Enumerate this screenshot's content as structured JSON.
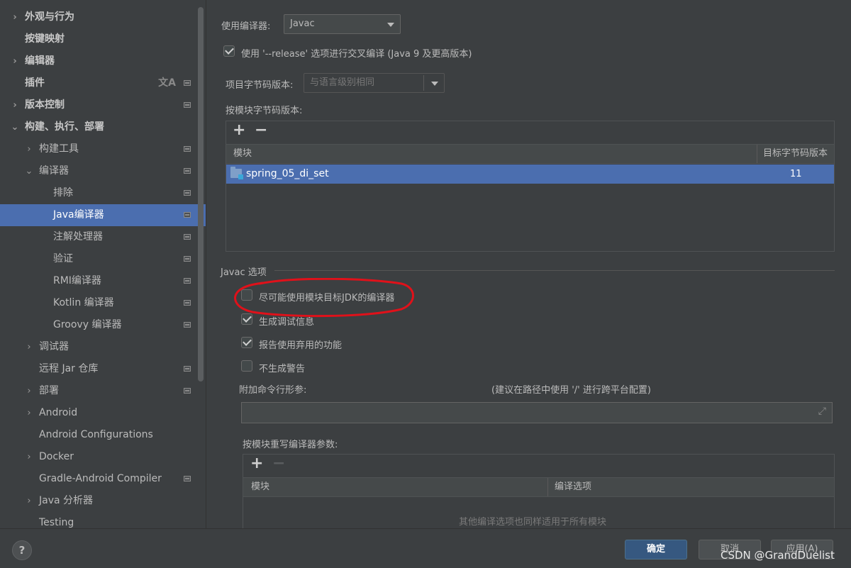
{
  "sidebar": {
    "items": [
      {
        "label": "外观与行为",
        "chevron": "›"
      },
      {
        "label": "按键映射",
        "chevron": ""
      },
      {
        "label": "编辑器",
        "chevron": "›"
      },
      {
        "label": "插件",
        "chevron": ""
      },
      {
        "label": "版本控制",
        "chevron": "›"
      },
      {
        "label": "构建、执行、部署",
        "chevron": "⌄"
      },
      {
        "label": "构建工具",
        "chevron": "›"
      },
      {
        "label": "编译器",
        "chevron": "⌄"
      },
      {
        "label": "排除",
        "chevron": ""
      },
      {
        "label": "Java编译器",
        "chevron": ""
      },
      {
        "label": "注解处理器",
        "chevron": ""
      },
      {
        "label": "验证",
        "chevron": ""
      },
      {
        "label": "RMI编译器",
        "chevron": ""
      },
      {
        "label": "Kotlin 编译器",
        "chevron": ""
      },
      {
        "label": "Groovy 编译器",
        "chevron": ""
      },
      {
        "label": "调试器",
        "chevron": "›"
      },
      {
        "label": "远程 Jar 仓库",
        "chevron": ""
      },
      {
        "label": "部署",
        "chevron": "›"
      },
      {
        "label": "Android",
        "chevron": "›"
      },
      {
        "label": "Android Configurations",
        "chevron": ""
      },
      {
        "label": "Docker",
        "chevron": "›"
      },
      {
        "label": "Gradle-Android Compiler",
        "chevron": ""
      },
      {
        "label": "Java 分析器",
        "chevron": "›"
      },
      {
        "label": "Testing",
        "chevron": ""
      }
    ],
    "translate_icon": "文A"
  },
  "compiler": {
    "use_compiler_label": "使用编译器:",
    "use_compiler_value": "Javac",
    "release_option_label": "使用 '--release' 选项进行交叉编译 (Java 9 及更高版本)",
    "release_option_checked": true,
    "bytecode_label": "项目字节码版本:",
    "bytecode_placeholder": "与语言级别相同",
    "per_module_label": "按模块字节码版本:",
    "module_table": {
      "add": "+",
      "remove": "−",
      "col_module": "模块",
      "col_target": "目标字节码版本",
      "rows": [
        {
          "module": "spring_05_di_set",
          "target": "11"
        }
      ]
    },
    "javac_section_title": "Javac 选项",
    "options": [
      {
        "label": "尽可能使用模块目标JDK的编译器",
        "checked": false
      },
      {
        "label": "生成调试信息",
        "checked": true
      },
      {
        "label": "报告使用弃用的功能",
        "checked": true
      },
      {
        "label": "不生成警告",
        "checked": false
      }
    ],
    "extra_args_label": "附加命令行形参:",
    "extra_args_hint": "(建议在路径中使用 '/' 进行跨平台配置)",
    "extra_args_value": "",
    "override_label": "按模块重写编译器参数:",
    "override_table": {
      "add": "+",
      "remove": "−",
      "col_module": "模块",
      "col_options": "编译选项",
      "empty_text": "其他编译选项也同样适用于所有模块"
    }
  },
  "footer": {
    "help": "?",
    "ok": "确定",
    "cancel": "取消",
    "apply": "应用(A)",
    "watermark": "CSDN @GrandDuelist"
  },
  "annotation_color": "#e0111a"
}
